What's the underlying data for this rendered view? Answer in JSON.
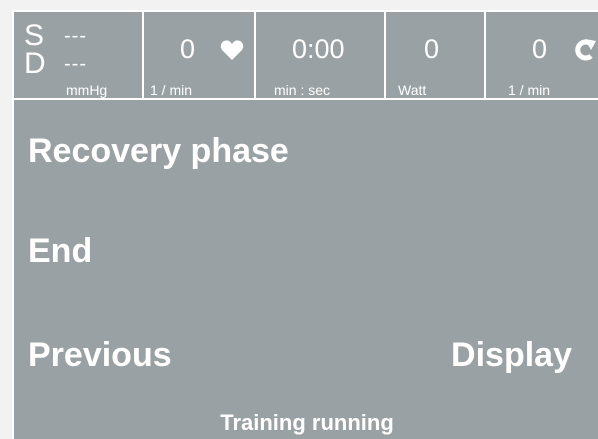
{
  "status_bar": {
    "blood_pressure": {
      "systolic_label": "S",
      "diastolic_label": "D",
      "systolic_value": "---",
      "diastolic_value": "---",
      "unit": "mmHg"
    },
    "heart_rate": {
      "value": "0",
      "unit": "1 / min",
      "icon": "heart-icon"
    },
    "time": {
      "value": "0:00",
      "unit": "min : sec"
    },
    "power": {
      "value": "0",
      "unit": "Watt"
    },
    "cadence": {
      "value": "0",
      "unit": "1 / min",
      "icon": "rotation-arrow-icon"
    }
  },
  "menu": {
    "title": "Recovery phase",
    "end_label": "End",
    "previous_label": "Previous",
    "display_label": "Display"
  },
  "footer": {
    "status": "Training running"
  },
  "colors": {
    "screen_background": "#99a1a4",
    "text": "#ffffff",
    "frame": "#f2f2f2"
  }
}
